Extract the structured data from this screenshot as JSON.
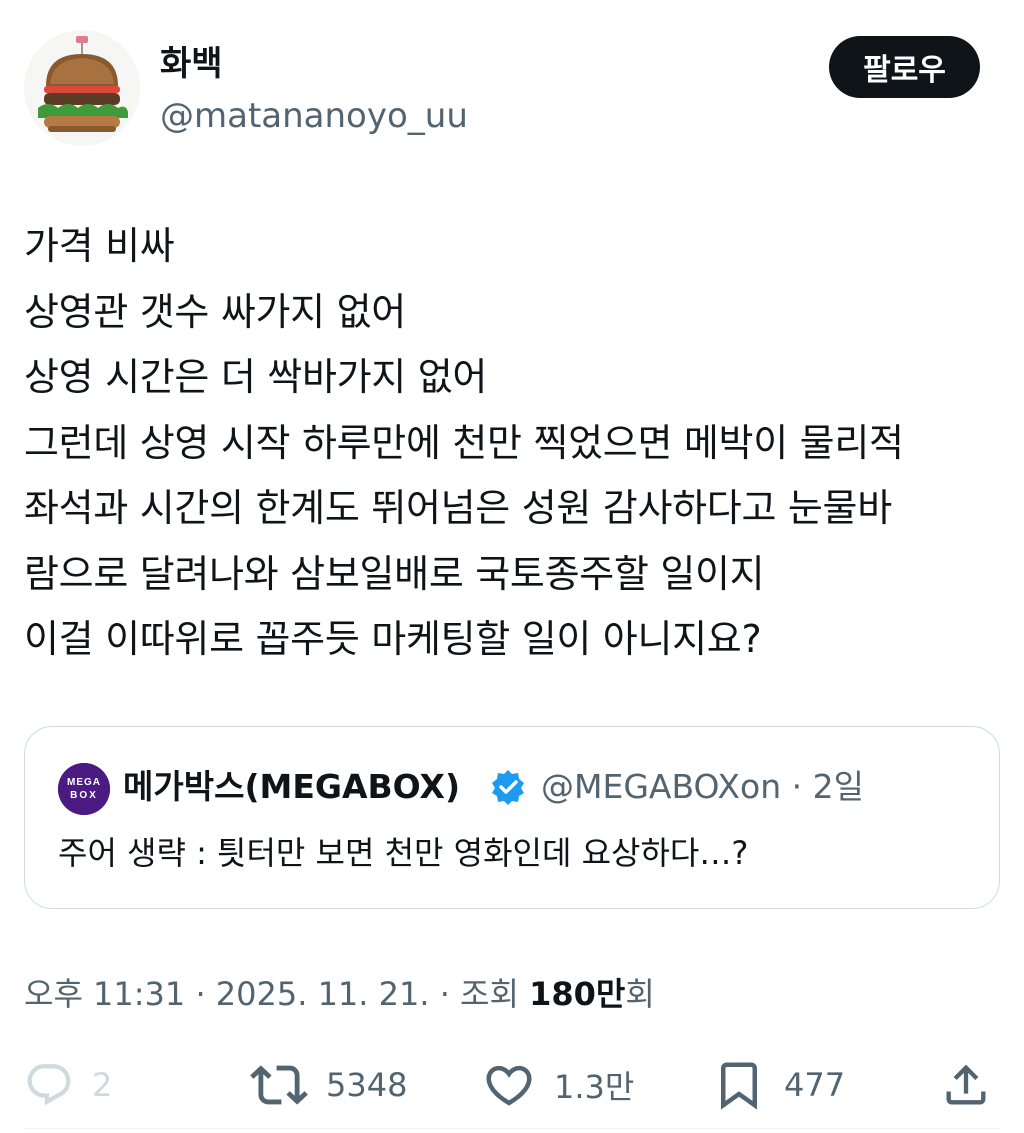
{
  "author": {
    "display_name": "화백",
    "handle": "@matananoyo_uu",
    "avatar_icon": "hamburger-avatar-icon",
    "follow_label": "팔로우"
  },
  "tweet": {
    "lines": [
      "가격 비싸",
      "상영관 갯수 싸가지 없어",
      "상영 시간은 더 싹바가지 없어",
      "그런데 상영 시작 하루만에 천만 찍었으면 메박이 물리적",
      "좌석과 시간의 한계도 뛰어넘은 성원 감사하다고 눈물바",
      "람으로 달려나와 삼보일배로 국토종주할 일이지",
      "이걸 이따위로 꼽주듯 마케팅할 일이 아니지요?"
    ]
  },
  "quote": {
    "name": "메가박스(MEGABOX)",
    "handle_time": "@MEGABOXon · 2일",
    "text": "주어 생략 : 틧터만 보면 천만 영화인데 요상하다…?",
    "logo_icon": "megabox-logo-icon",
    "logo_text": "MEGABOX",
    "verified_icon": "verified-badge-icon"
  },
  "meta": {
    "time_date": "오후 11:31 · 2025. 11. 21. · 조회 ",
    "views_count": "180만",
    "views_suffix": "회"
  },
  "actions": {
    "reply_count": "2",
    "retweet_count": "5348",
    "like_count": "1.3만",
    "bookmark_count": "477"
  },
  "colors": {
    "primary_text": "#0f1419",
    "secondary_text": "#536471",
    "border": "#cfd9de",
    "verified": "#1d9bf0",
    "megabox_purple": "#4b1b83"
  }
}
